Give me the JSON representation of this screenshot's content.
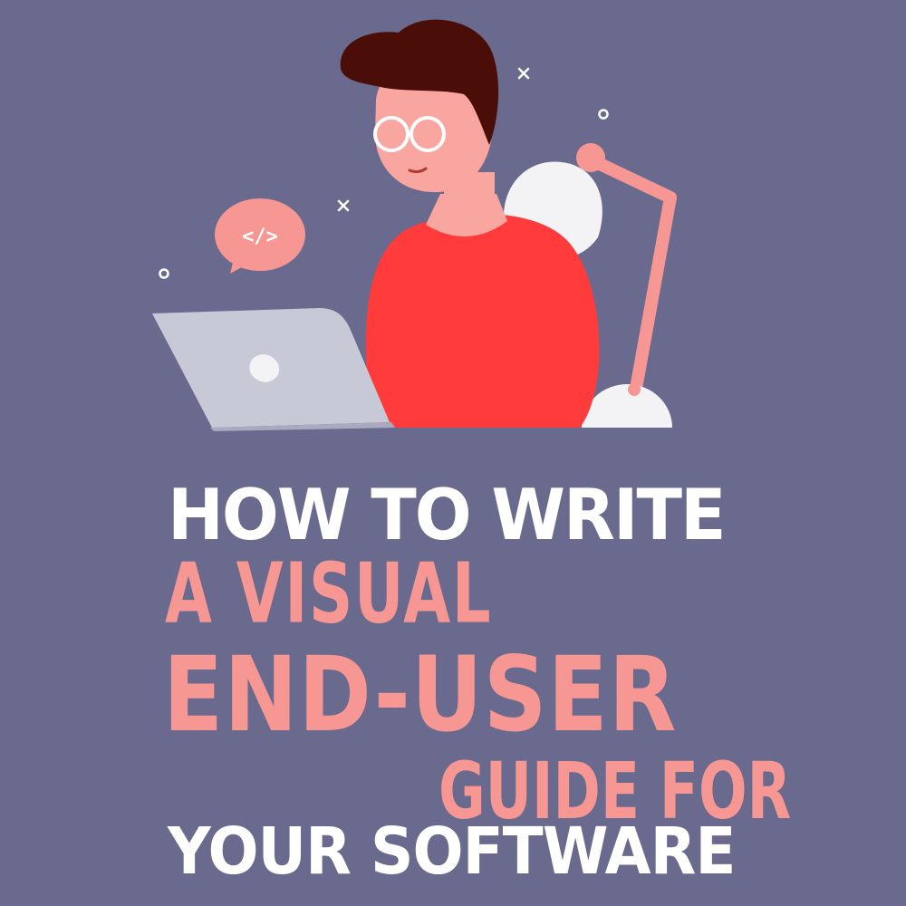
{
  "headline": {
    "line1": "HOW TO WRITE",
    "line2": "A VISUAL",
    "line3": "END-USER",
    "line4": "GUIDE FOR",
    "line5": "YOUR SOFTWARE"
  },
  "code_bubble": {
    "text": "</>"
  },
  "colors": {
    "background": "#696a8e",
    "title_white": "#ffffff",
    "title_pink": "#f79793",
    "sweater": "#ff3b3b",
    "skin": "#f9a5a0",
    "hair": "#4a0d07",
    "laptop": "#c8c9d7",
    "lamp_arm": "#f79793",
    "lamp_shade": "#f3f3f6"
  },
  "icons": [
    "code-bubble-icon",
    "sparkle-x-icon",
    "sparkle-o-icon",
    "laptop-logo-icon"
  ]
}
